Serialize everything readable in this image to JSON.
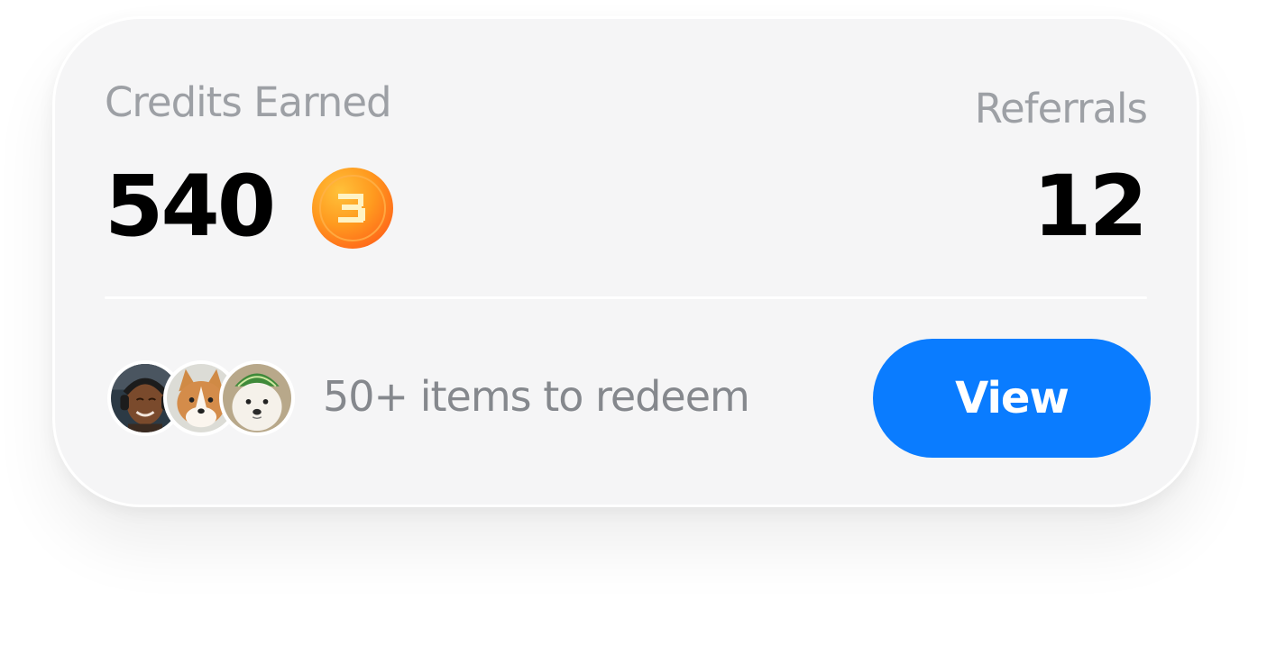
{
  "credits": {
    "label": "Credits Earned",
    "value": "540",
    "coin_icon": "coin-icon"
  },
  "referrals": {
    "label": "Referrals",
    "value": "12"
  },
  "redeem": {
    "avatars": [
      "avatar-person-headphones",
      "avatar-corgi",
      "avatar-white-dog-watermelon-hat"
    ],
    "text": "50+ items to redeem",
    "button_label": "View"
  },
  "colors": {
    "card_background": "#f5f5f6",
    "label_gray": "#9da0a5",
    "secondary_text_gray": "#85888d",
    "button_blue": "#0a7cff",
    "coin_orange": "#ff8c1a"
  }
}
